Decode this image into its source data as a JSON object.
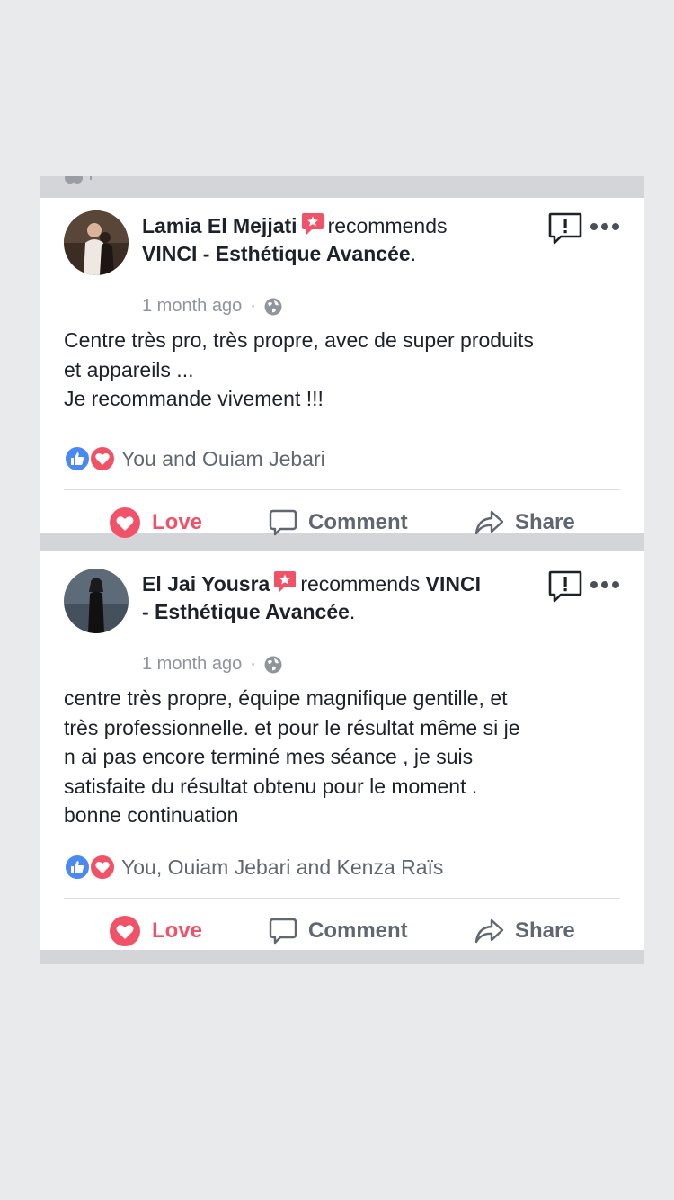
{
  "colors": {
    "background": "#e9eaec",
    "feed_separator": "#d3d5d9",
    "card": "#ffffff",
    "text": "#1d2129",
    "muted": "#90949c",
    "love": "#f0526a",
    "like": "#4a89f3",
    "badge": "#f25268"
  },
  "posts": [
    {
      "author": "Lamia El Mejjati",
      "recommend_verb": "recommends",
      "page": "VINCI - Esthétique Avancée",
      "period": ".",
      "time": "1 month ago",
      "dot": "·",
      "body": "Centre très pro, très propre, avec de super produits\net appareils ...\nJe recommande vivement !!!",
      "reactions_text": "You and Ouiam Jebari",
      "actions": {
        "love": "Love",
        "comment": "Comment",
        "share": "Share"
      },
      "icons": [
        "avatar",
        "recommend-badge-icon",
        "globe-icon",
        "report-icon",
        "more-icon",
        "like-reaction-icon",
        "love-reaction-icon",
        "heart-icon",
        "comment-icon",
        "share-icon"
      ]
    },
    {
      "author": "El Jai Yousra",
      "recommend_verb": "recommends",
      "page_line1": "VINCI",
      "page_line2": "- Esthétique Avancée",
      "period": ".",
      "time": "1 month ago",
      "dot": "·",
      "body": "centre très propre, équipe magnifique  gentille,  et\ntrès professionnelle. et pour le résultat  même si je\nn ai pas encore terminé mes séance  , je suis\nsatisfaite du résultat  obtenu pour le moment .\nbonne continuation",
      "reactions_text": "You, Ouiam Jebari and Kenza Raïs",
      "actions": {
        "love": "Love",
        "comment": "Comment",
        "share": "Share"
      },
      "icons": [
        "avatar",
        "recommend-badge-icon",
        "globe-icon",
        "report-icon",
        "more-icon",
        "like-reaction-icon",
        "love-reaction-icon",
        "heart-icon",
        "comment-icon",
        "share-icon"
      ]
    }
  ]
}
